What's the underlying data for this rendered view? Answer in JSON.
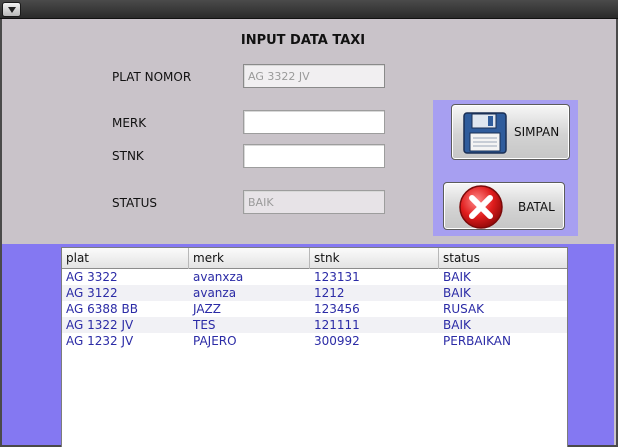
{
  "window": {
    "menu_icon": "chevron-down-icon"
  },
  "form": {
    "title": "INPUT DATA TAXI",
    "labels": {
      "plat": "PLAT NOMOR",
      "merk": "MERK",
      "stnk": "STNK",
      "status": "STATUS"
    },
    "values": {
      "plat": "AG 3322 JV",
      "merk": "",
      "stnk": "",
      "status": "BAIK"
    }
  },
  "buttons": {
    "save": {
      "label": "SIMPAN",
      "icon": "floppy-disk-icon"
    },
    "cancel": {
      "label": "BATAL",
      "icon": "cancel-x-icon"
    }
  },
  "table": {
    "columns": [
      "plat",
      "merk",
      "stnk",
      "status"
    ],
    "rows": [
      [
        "AG 3322",
        "avanxza",
        "123131",
        "BAIK"
      ],
      [
        "AG 3122",
        "avanza",
        "1212",
        "BAIK"
      ],
      [
        "AG 6388 BB",
        "JAZZ",
        "123456",
        "RUSAK"
      ],
      [
        "AG 1322 JV",
        "TES",
        "121111",
        "BAIK"
      ],
      [
        "AG 1232 JV",
        "PAJERO",
        "300992",
        "PERBAIKAN"
      ]
    ]
  },
  "colors": {
    "background": "#c9c3c9",
    "band": "#8478f2",
    "button_panel": "#a79ff1",
    "table_text": "#2b2ba6"
  }
}
